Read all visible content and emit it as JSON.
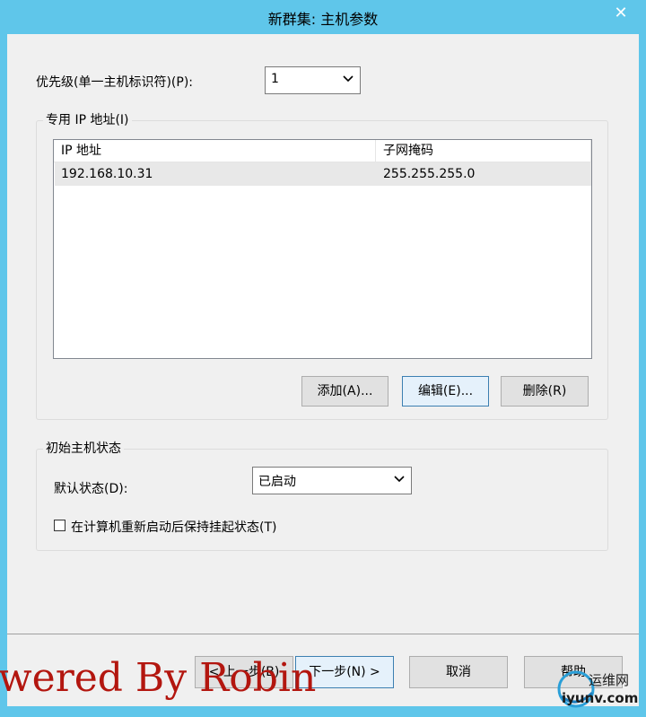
{
  "window": {
    "title": "新群集: 主机参数",
    "close_glyph": "✕"
  },
  "priority": {
    "label": "优先级(单一主机标识符)(P):",
    "value": "1"
  },
  "dedicated_ip": {
    "group_label": "专用 IP 地址(I)",
    "columns": [
      "IP 地址",
      "子网掩码"
    ],
    "rows": [
      {
        "ip": "192.168.10.31",
        "mask": "255.255.255.0"
      }
    ],
    "add_label": "添加(A)...",
    "edit_label": "编辑(E)...",
    "delete_label": "删除(R)"
  },
  "initial_state": {
    "group_label": "初始主机状态",
    "default_state_label": "默认状态(D):",
    "default_state_value": "已启动",
    "retain_suspended_label": "在计算机重新启动后保持挂起状态(T)",
    "retain_suspended_checked": false
  },
  "footer": {
    "back_label": "< 上一步(B)",
    "next_label": "下一步(N) >",
    "cancel_label": "取消",
    "help_label": "帮助"
  },
  "watermark": {
    "text": "wered By Robin",
    "logo_text": "运维网",
    "logo_url_text": "iyunv.com"
  },
  "colors": {
    "titlebar": "#5fc6ea",
    "client": "#f0f0f0",
    "watermark": "#b3160f"
  }
}
